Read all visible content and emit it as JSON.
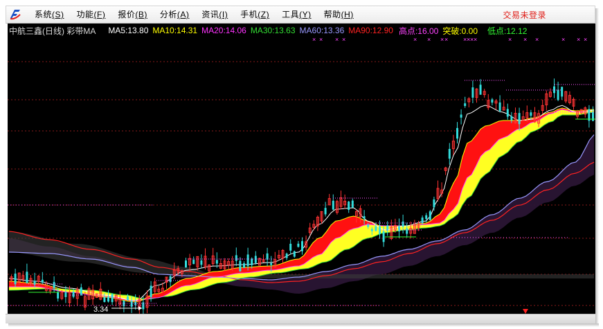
{
  "menubar": {
    "logo_icon": "app-logo-icon",
    "items": [
      {
        "label": "系统",
        "hotkey": "(S)"
      },
      {
        "label": "功能",
        "hotkey": "(F)"
      },
      {
        "label": "报价",
        "hotkey": "(B)"
      },
      {
        "label": "分析",
        "hotkey": "(A)"
      },
      {
        "label": "资讯",
        "hotkey": "(I)"
      },
      {
        "label": "手机",
        "hotkey": "(Z)"
      },
      {
        "label": "工具",
        "hotkey": "(Y)"
      },
      {
        "label": "帮助",
        "hotkey": "(H)"
      }
    ],
    "login_label": "交易未登录"
  },
  "legend": {
    "stock": "中航三鑫(日线) 彩带MA",
    "ma5": "MA5:13.80",
    "ma10": "MA10:14.31",
    "ma20": "MA20:14.06",
    "ma30": "MA30:13.63",
    "ma60": "MA60:13.36",
    "ma90": "MA90:12.90",
    "high": "高点:16.00",
    "breakout": "突破:0.00",
    "low": "低点:12.12"
  },
  "colors": {
    "ma5": "#ffffff",
    "ma10": "#ffff00",
    "ma20": "#ff33ff",
    "ma30": "#33dd33",
    "ma60": "#9999ff",
    "ma90": "#ff2222",
    "up": "#ff3333",
    "down": "#33dddd",
    "band_red": "#ff1111",
    "band_yellow": "#ffff22"
  },
  "chart_data": {
    "type": "line",
    "title": "中航三鑫(日线) 彩带MA",
    "low_label": "3.34",
    "marker": "×",
    "series": [
      {
        "name": "MA5",
        "value": 13.8
      },
      {
        "name": "MA10",
        "value": 14.31
      },
      {
        "name": "MA20",
        "value": 14.06
      },
      {
        "name": "MA30",
        "value": 13.63
      },
      {
        "name": "MA60",
        "value": 13.36
      },
      {
        "name": "MA90",
        "value": 12.9
      }
    ],
    "grid": true
  }
}
